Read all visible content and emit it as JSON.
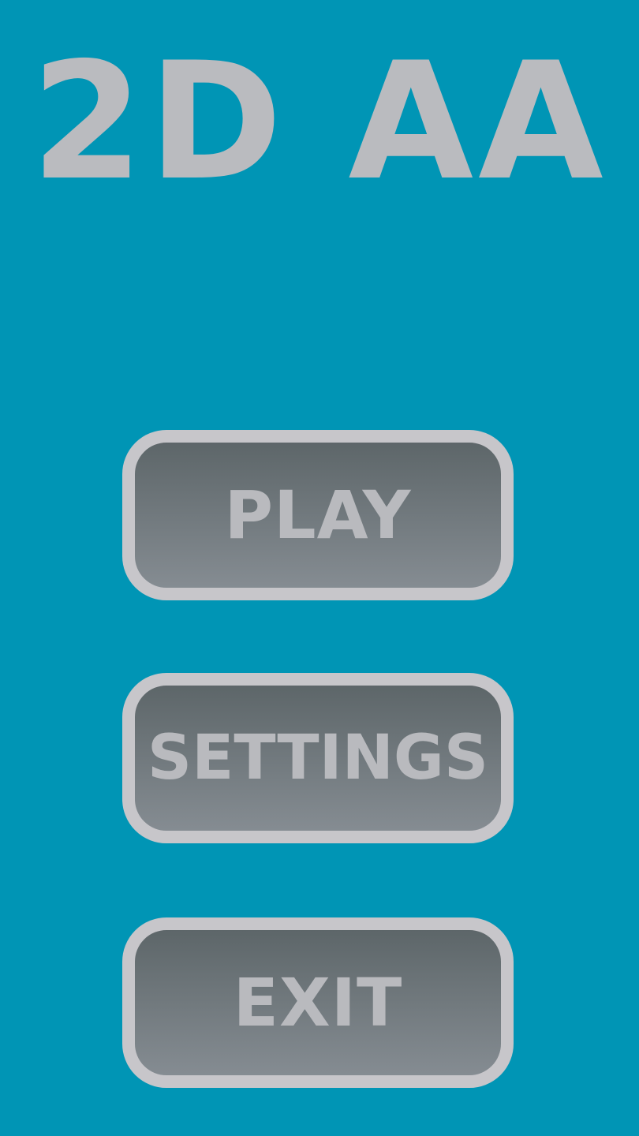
{
  "game": {
    "title": "2D AA"
  },
  "menu": {
    "play_label": "PLAY",
    "settings_label": "SETTINGS",
    "exit_label": "EXIT"
  },
  "colors": {
    "background": "#0095b5",
    "title_text": "#babbbf",
    "button_border": "#c7c6ca",
    "button_gradient_top": "#5d6669",
    "button_gradient_bottom": "#858c92",
    "button_text": "#b9babe"
  }
}
